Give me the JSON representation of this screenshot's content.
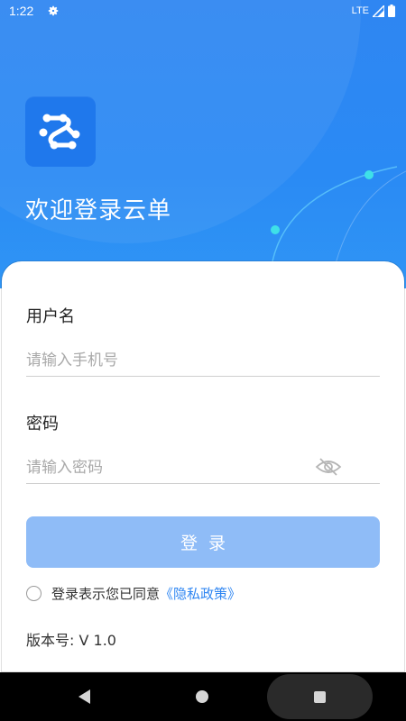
{
  "status": {
    "time": "1:22",
    "network": "LTE"
  },
  "header": {
    "title": "欢迎登录云单"
  },
  "form": {
    "username_label": "用户名",
    "username_placeholder": "请输入手机号",
    "password_label": "密码",
    "password_placeholder": "请输入密码",
    "login_label": "登录"
  },
  "agreement": {
    "text": "登录表示您已同意",
    "link": "《隐私政策》"
  },
  "version": "版本号: V 1.0",
  "colors": {
    "primary": "#2f86f2",
    "button": "#8fbcf7",
    "accent_dot": "#3ee0e8"
  },
  "icons": [
    "gear-icon",
    "signal-icon",
    "battery-icon",
    "app-logo-icon",
    "eye-off-icon",
    "back-icon",
    "home-icon",
    "recents-icon"
  ]
}
